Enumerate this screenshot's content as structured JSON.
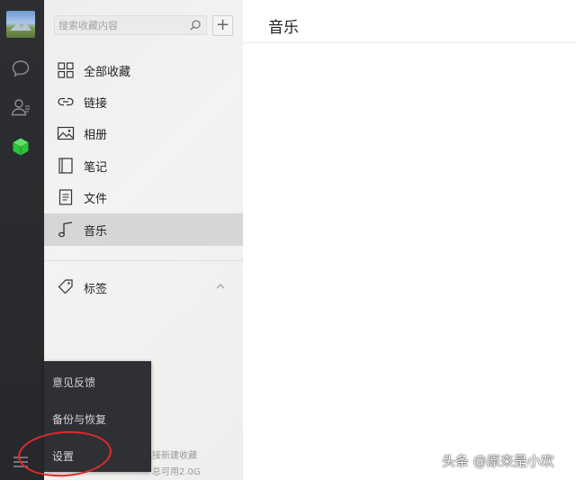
{
  "search": {
    "placeholder": "搜索收藏内容"
  },
  "add_button": "+",
  "nav": [
    {
      "label": "全部收藏",
      "icon": "grid-icon"
    },
    {
      "label": "链接",
      "icon": "link-icon"
    },
    {
      "label": "相册",
      "icon": "photo-icon"
    },
    {
      "label": "笔记",
      "icon": "notebook-icon"
    },
    {
      "label": "文件",
      "icon": "file-icon"
    },
    {
      "label": "音乐",
      "icon": "music-note-icon",
      "selected": true
    }
  ],
  "tags": {
    "label": "标签",
    "icon": "tag-icon",
    "expanded": true
  },
  "popup_menu": [
    {
      "label": "意见反馈"
    },
    {
      "label": "备份与恢复"
    },
    {
      "label": "设置"
    }
  ],
  "footer": {
    "line1": "连接新建收藏",
    "line2": "总可用2.0G"
  },
  "content": {
    "title": "音乐"
  },
  "watermark": "头条 @原来是小欢",
  "colors": {
    "favorites_accent": "#2dc43d",
    "selected_bg": "#d8d6d5",
    "popup_bg": "#2e3033",
    "highlight_ring": "#e02a2a"
  }
}
